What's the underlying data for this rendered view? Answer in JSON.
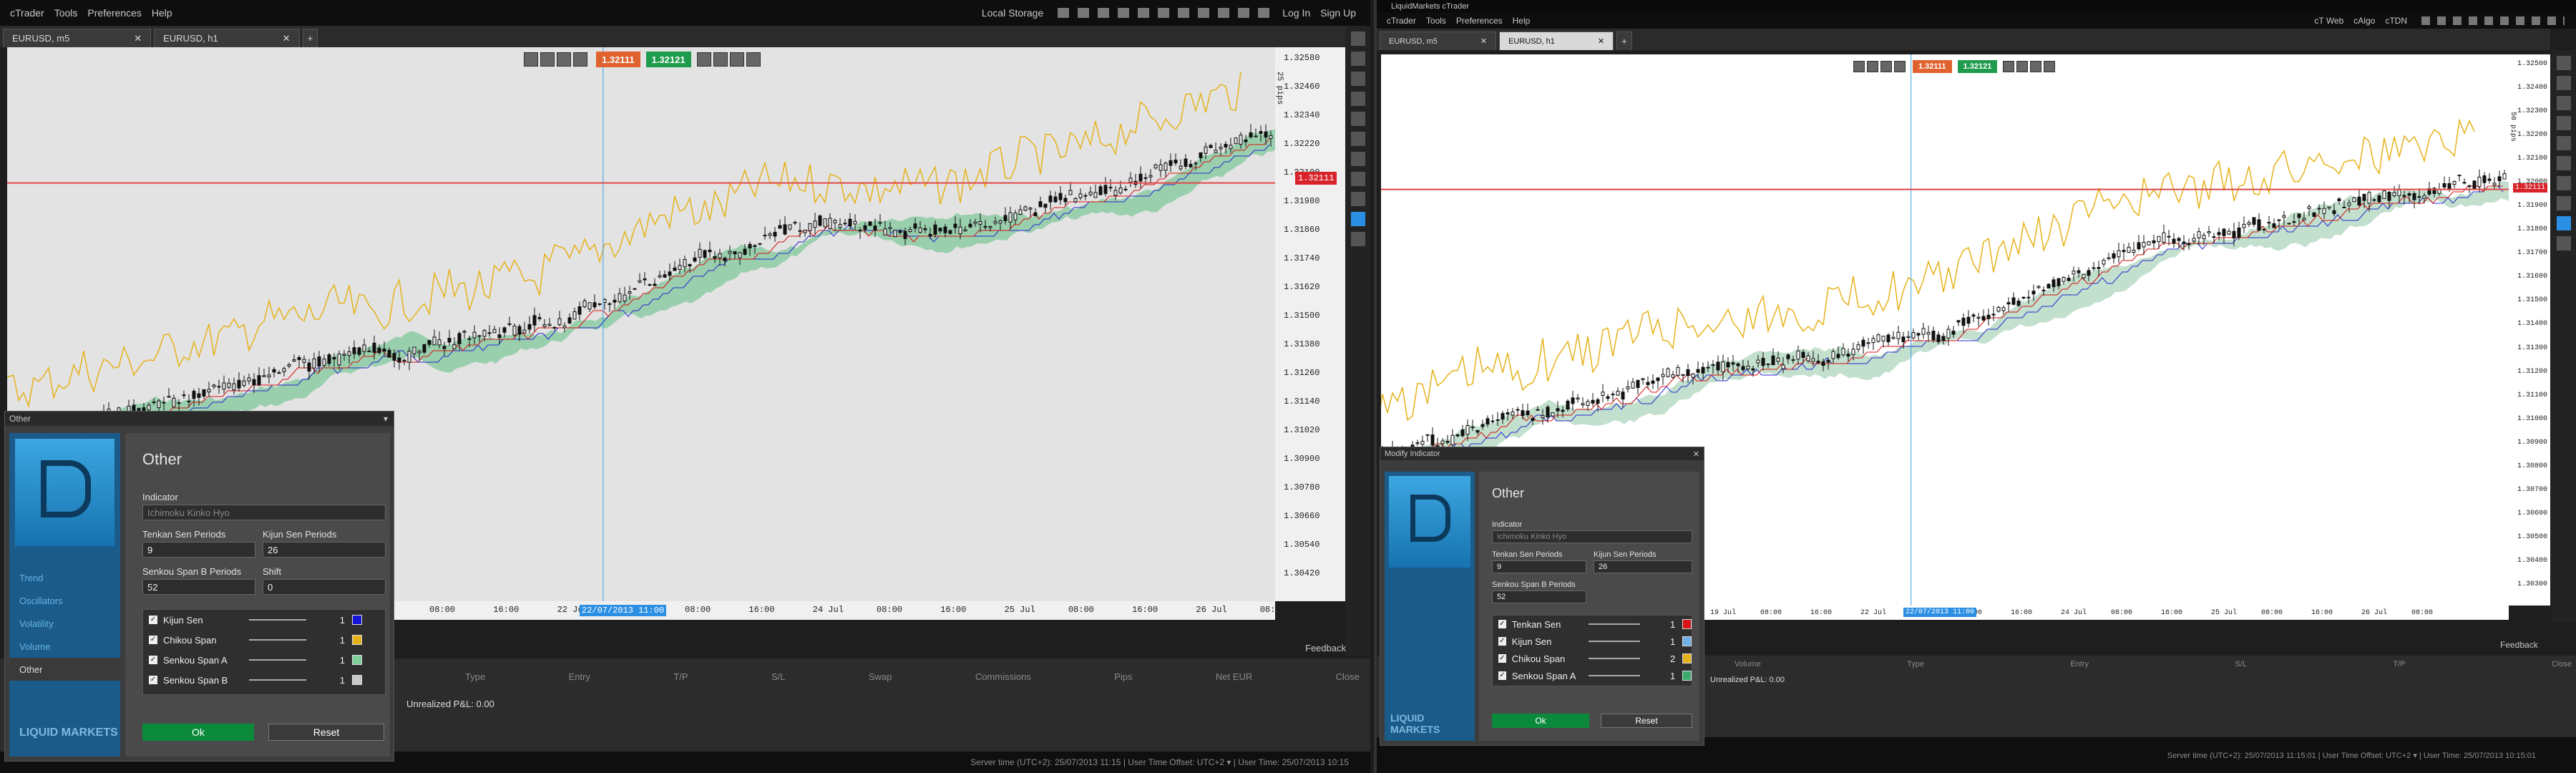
{
  "left": {
    "menu": [
      "cTrader",
      "Tools",
      "Preferences",
      "Help"
    ],
    "menu_right": [
      "Local Storage",
      "Log In",
      "Sign Up"
    ],
    "tabs": [
      "EURUSD, m5",
      "EURUSD, h1"
    ],
    "bid": "1.32111",
    "ask": "1.32121",
    "axis_label": "25 pips",
    "current_price": "1.32111",
    "price_ticks": [
      "1.32580",
      "1.32460",
      "1.32340",
      "1.32220",
      "1.32100",
      "1.31980",
      "1.31860",
      "1.31740",
      "1.31620",
      "1.31500",
      "1.31380",
      "1.31260",
      "1.31140",
      "1.31020",
      "1.30900",
      "1.30780",
      "1.30660",
      "1.30540",
      "1.30420"
    ],
    "time_ticks": [
      "08:00",
      "16:00",
      "22 Jul",
      "23 Jul",
      "08:00",
      "16:00",
      "24 Jul",
      "08:00",
      "16:00",
      "25 Jul",
      "08:00",
      "16:00",
      "26 Jul",
      "08:00"
    ],
    "crosshair_time": "22/07/2013 11:00",
    "sub_ticks": [
      "00:00",
      ":00"
    ],
    "feedback": "Feedback",
    "columns": [
      "Type",
      "Entry",
      "T/P",
      "S/L",
      "Swap",
      "Commissions",
      "Pips",
      "Net EUR",
      "Close"
    ],
    "pnl": "Unrealized P&L: 0.00",
    "status": "Server time (UTC+2): 25/07/2013 11:15 | User Time Offset: UTC+2 ▾ | User Time: 25/07/2013 10:15"
  },
  "right": {
    "title": "LiquidMarkets cTrader",
    "menu": [
      "cTrader",
      "Tools",
      "Preferences",
      "Help"
    ],
    "menu_right": [
      "cT Web",
      "cAlgo",
      "cTDN"
    ],
    "tabs": [
      "EURUSD, m5",
      "EURUSD, h1"
    ],
    "bid": "1.32111",
    "ask": "1.32121",
    "axis_label": "50 pips",
    "current_price": "1.32111",
    "price_ticks": [
      "1.32500",
      "1.32400",
      "1.32300",
      "1.32200",
      "1.32100",
      "1.32000",
      "1.31900",
      "1.31800",
      "1.31700",
      "1.31600",
      "1.31500",
      "1.31400",
      "1.31300",
      "1.31200",
      "1.31100",
      "1.31000",
      "1.30900",
      "1.30800",
      "1.30700",
      "1.30600",
      "1.30500",
      "1.30400",
      "1.30300"
    ],
    "time_ticks": [
      "19 Jul",
      "08:00",
      "16:00",
      "22 Jul",
      "23 Jul",
      "08:00",
      "16:00",
      "24 Jul",
      "08:00",
      "16:00",
      "25 Jul",
      "08:00",
      "16:00",
      "26 Jul",
      "08:00"
    ],
    "crosshair_time": "22/07/2013 11:00",
    "feedback": "Feedback",
    "columns": [
      "Volume",
      "Type",
      "Entry",
      "S/L",
      "T/P",
      "Close"
    ],
    "pnl": "Unrealized P&L: 0.00",
    "status": "Server time (UTC+2): 25/07/2013 11:15:01 | User Time Offset: UTC+2 ▾ | User Time: 25/07/2013 10:15:01"
  },
  "dialog_left": {
    "title": "Other",
    "heading": "Other",
    "nav": [
      "Trend",
      "Oscillators",
      "Volatility",
      "Volume",
      "Other"
    ],
    "indicator_label": "Indicator",
    "indicator_value": "Ichimoku Kinko Hyo",
    "tenkan_label": "Tenkan Sen Periods",
    "tenkan_value": "9",
    "kijun_label": "Kijun Sen Periods",
    "kijun_value": "26",
    "senkou_label": "Senkou Span B Periods",
    "senkou_value": "52",
    "shift_label": "Shift",
    "shift_value": "0",
    "lines": [
      {
        "name": "Kijun Sen",
        "width": "1",
        "color": "#1414d8"
      },
      {
        "name": "Chikou Span",
        "width": "1",
        "color": "#e6b21a"
      },
      {
        "name": "Senkou Span A",
        "width": "1",
        "color": "#7fcf9a"
      },
      {
        "name": "Senkou Span B",
        "width": "1",
        "color": "#c8c8c8"
      }
    ],
    "ok": "Ok",
    "reset": "Reset",
    "logo": "LIQUID MARKETS"
  },
  "dialog_right": {
    "title": "Modify Indicator",
    "heading": "Other",
    "indicator_label": "Indicator",
    "indicator_value": "Ichimoku Kinko Hyo",
    "tenkan_label": "Tenkan Sen Periods",
    "tenkan_value": "9",
    "kijun_label": "Kijun Sen Periods",
    "kijun_value": "26",
    "senkou_label": "Senkou Span B Periods",
    "senkou_value": "52",
    "lines": [
      {
        "name": "Tenkan Sen",
        "width": "1",
        "color": "#d81414"
      },
      {
        "name": "Kijun Sen",
        "width": "1",
        "color": "#6fb0e6"
      },
      {
        "name": "Chikou Span",
        "width": "2",
        "color": "#e6b21a"
      },
      {
        "name": "Senkou Span A",
        "width": "1",
        "color": "#3aa96a"
      }
    ],
    "ok": "Ok",
    "reset": "Reset",
    "logo": "LIQUID MARKETS"
  }
}
